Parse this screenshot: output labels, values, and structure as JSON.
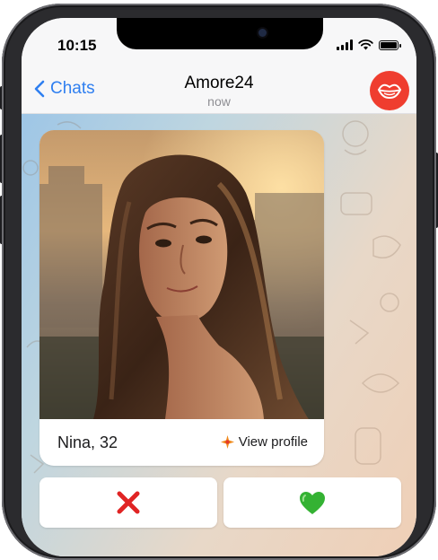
{
  "status_bar": {
    "time": "10:15",
    "icons": [
      "signal-icon",
      "wifi-icon",
      "battery-icon"
    ]
  },
  "nav": {
    "back_label": "Chats",
    "title": "Amore24",
    "subtitle": "now",
    "avatar_icon": "lips-icon"
  },
  "profile_card": {
    "name_age": "Nina, 32",
    "view_profile_label": "View profile",
    "view_profile_icon": "sparkle-icon"
  },
  "actions": {
    "reject_icon": "red-x-icon",
    "like_icon": "green-heart-icon"
  },
  "colors": {
    "accent_blue": "#2f7ff0",
    "brand_red": "#ef3d2f",
    "reject_red": "#e02424",
    "like_green": "#34b233"
  }
}
